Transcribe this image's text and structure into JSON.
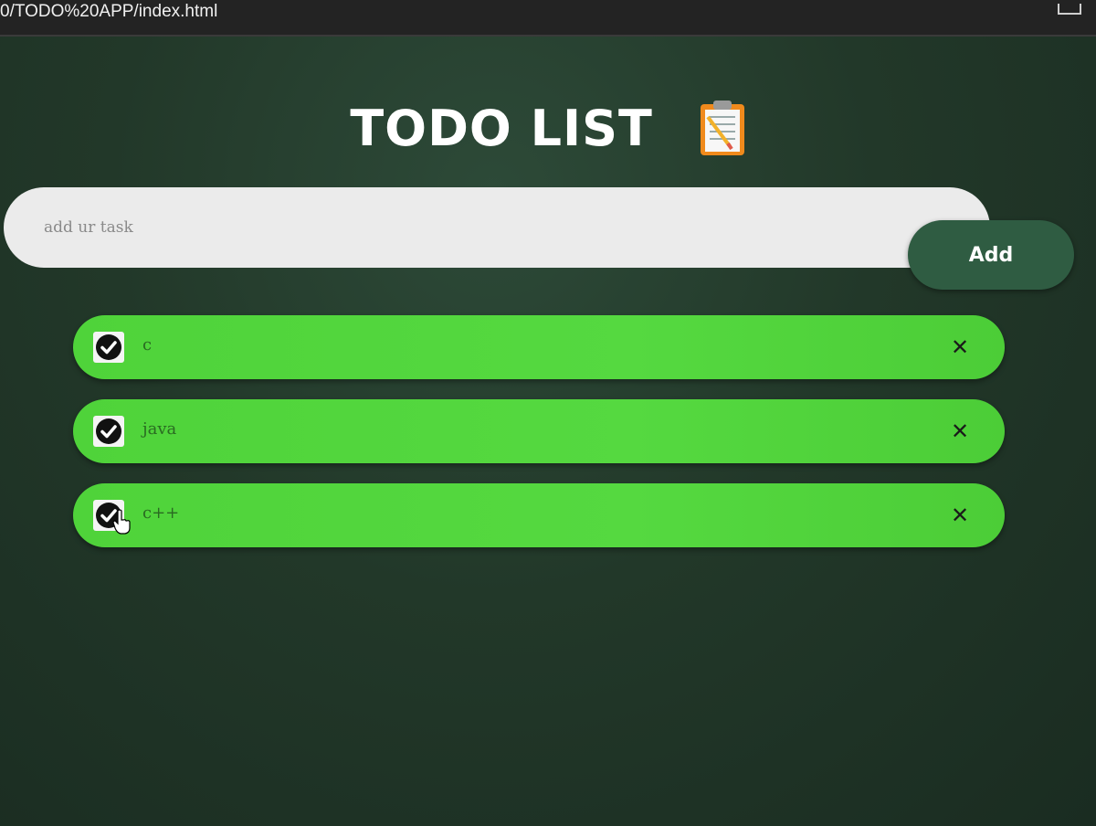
{
  "browser": {
    "url": "0/TODO%20APP/index.html"
  },
  "app": {
    "title": "TODO LIST",
    "title_icon": "clipboard-icon",
    "input": {
      "placeholder": "add ur task",
      "value": ""
    },
    "add_button_label": "Add",
    "tasks": [
      {
        "text": "c",
        "checked": true
      },
      {
        "text": "java",
        "checked": true
      },
      {
        "text": "c++",
        "checked": true
      }
    ]
  },
  "colors": {
    "background": "#223829",
    "task_bg": "#52d63d",
    "add_button": "#2f5c42",
    "input_bg": "#ebebeb"
  }
}
